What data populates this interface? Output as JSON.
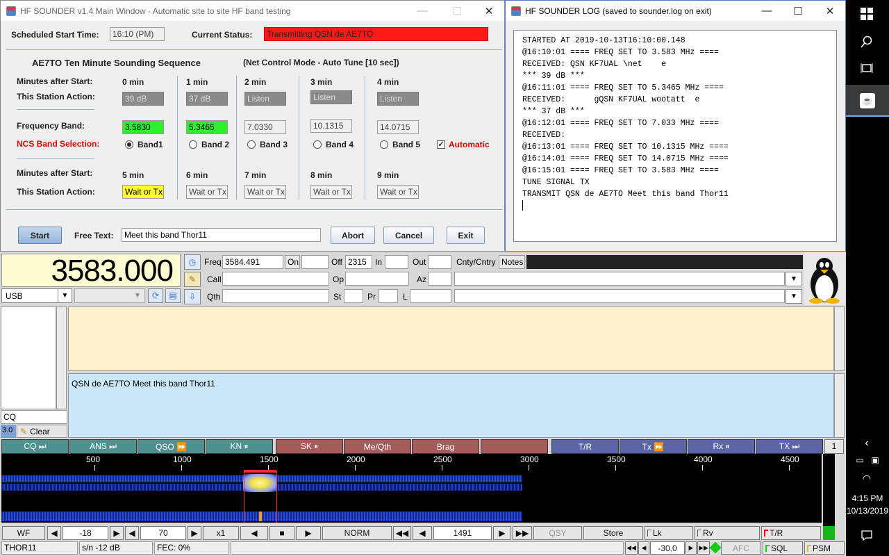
{
  "sounder": {
    "title": "HF SOUNDER v1.4 Main Window - Automatic site to site HF band testing",
    "scheduled_label": "Scheduled Start Time:",
    "scheduled_value": "16:10 (PM)",
    "status_label": "Current Status:",
    "status_value": "Transmitting QSN de AE7TO",
    "sequence_title": "AE7TO  Ten Minute Sounding Sequence",
    "mode_label": "(Net Control Mode - Auto Tune [10 sec])",
    "minutes_label": "Minutes after Start:",
    "action_label": "This Station Action:",
    "freq_label": "Frequency Band:",
    "ncs_label": "NCS Band Selection:",
    "minutes_label2": "Minutes after Start:",
    "action_label2": "This Station Action:",
    "columns": [
      {
        "min": "0 min",
        "action": "39 dB",
        "freq": "3.5830",
        "band": "Band1",
        "min2": "5 min",
        "action2": "Wait or Tx"
      },
      {
        "min": "1 min",
        "action": "37 dB",
        "freq": "5.3465",
        "band": "Band 2",
        "min2": "6 min",
        "action2": "Wait or Tx"
      },
      {
        "min": "2 min",
        "action": "Listen",
        "freq": "7.0330",
        "band": "Band 3",
        "min2": "7 min",
        "action2": "Wait or Tx"
      },
      {
        "min": "3 min",
        "action": "Listen",
        "freq": "10.1315",
        "band": "Band 4",
        "min2": "8 min",
        "action2": "Wait or Tx"
      },
      {
        "min": "4 min",
        "action": "Listen",
        "freq": "14.0715",
        "band": "Band 5",
        "min2": "9 min",
        "action2": "Wait or Tx"
      }
    ],
    "automatic_label": "Automatic",
    "start_btn": "Start",
    "free_text_label": "Free Text:",
    "free_text_value": "Meet this band Thor11",
    "abort_btn": "Abort",
    "cancel_btn": "Cancel",
    "exit_btn": "Exit"
  },
  "log": {
    "title": "HF SOUNDER LOG (saved to sounder.log on exit)",
    "lines": [
      "STARTED AT 2019-10-13T16:10:00.148",
      "@16:10:01 ==== FREQ SET TO 3.583 MHz ====",
      "RECEIVED: QSN KF7UAL \\net    e",
      "*** 39 dB ***",
      "@16:11:01 ==== FREQ SET TO 5.3465 MHz ====",
      "RECEIVED:      gQSN KF7UAL wootatt  e",
      "*** 37 dB ***",
      "@16:12:01 ==== FREQ SET TO 7.033 MHz ====",
      "RECEIVED:",
      "@16:13:01 ==== FREQ SET TO 10.1315 MHz ====",
      "@16:14:01 ==== FREQ SET TO 14.0715 MHz ====",
      "@16:15:01 ==== FREQ SET TO 3.583 MHz ====",
      "TUNE SIGNAL TX",
      "TRANSMIT QSN de AE7TO Meet this band Thor11"
    ]
  },
  "fldigi": {
    "frequency": "3583.000",
    "mode": "USB",
    "freq_label": "Freq",
    "freq_value": "3584.491",
    "on_label": "On",
    "off_label": "Off",
    "off_value": "2315",
    "in_label": "In",
    "out_label": "Out",
    "cnty_label": "Cnty/Cntry",
    "notes_label": "Notes",
    "call_label": "Call",
    "op_label": "Op",
    "az_label": "Az",
    "qth_label": "Qth",
    "st_label": "St",
    "pr_label": "Pr",
    "l_label": "L",
    "cq_text": "CQ",
    "clear_label": "Clear",
    "side_value": "3.0",
    "tx_text": "QSN de AE7TO Meet this band Thor11",
    "macros": [
      {
        "label": "CQ ⏭",
        "c": "g"
      },
      {
        "label": "ANS ⏭",
        "c": "g"
      },
      {
        "label": "QSO ⏩",
        "c": "g"
      },
      {
        "label": "KN ⏸",
        "c": "g"
      },
      {
        "label": "SK ⏸",
        "c": "r"
      },
      {
        "label": "Me/Qth",
        "c": "r"
      },
      {
        "label": "Brag",
        "c": "r"
      },
      {
        "label": "",
        "c": "r"
      },
      {
        "label": "T/R",
        "c": "b"
      },
      {
        "label": "Tx ⏩",
        "c": "b"
      },
      {
        "label": "Rx ⏸",
        "c": "b"
      },
      {
        "label": "TX ⏭",
        "c": "b"
      }
    ],
    "macro_page": "1",
    "ticks": [
      "500",
      "1000",
      "1500",
      "2000",
      "2500",
      "3000",
      "3500",
      "4000",
      "4500"
    ],
    "wf_btn": "WF",
    "ref_value": "-18",
    "range_value": "70",
    "zoom": "x1",
    "norm": "NORM",
    "carrier": "1491",
    "qsy": "QSY",
    "store": "Store",
    "lk": "Lk",
    "rv": "Rv",
    "tr": "T/R",
    "status_mode": "THOR11",
    "status_sn": "s/n -12 dB",
    "status_fec": "FEC:   0%",
    "sql_value": "-30.0",
    "afc": "AFC",
    "sql": "SQL",
    "psm": "PSM"
  },
  "taskbar": {
    "time": "4:15 PM",
    "date": "10/13/2019"
  },
  "colors": {
    "status_red": "#ff1a1a",
    "green_field": "#2df02d",
    "yellow_field": "#ffff2a",
    "rx_pane": "#fdf2cd",
    "tx_pane": "#cbe8fb"
  }
}
